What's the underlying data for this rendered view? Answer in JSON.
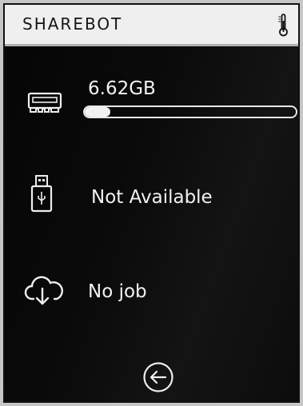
{
  "header": {
    "title": "SHAREBOT",
    "temperature_icon": "thermometer-icon"
  },
  "storage": {
    "icon": "memory-card-icon",
    "value": "6.62GB",
    "usage_fraction": 0.12
  },
  "usb": {
    "icon": "usb-drive-icon",
    "status": "Not Available"
  },
  "job": {
    "icon": "cloud-download-icon",
    "status": "No job"
  },
  "footer": {
    "back_icon": "back-arrow-icon"
  },
  "colors": {
    "background": "#0a0a0a",
    "header_background": "#efefef",
    "foreground": "#f2f2f2",
    "bezel": "#c6c6c6"
  }
}
